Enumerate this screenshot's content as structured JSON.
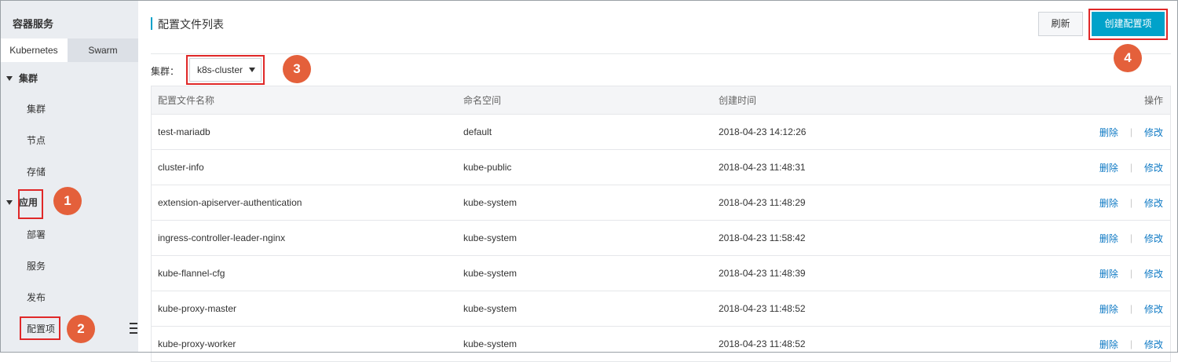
{
  "sidebar": {
    "title": "容器服务",
    "tabs": [
      {
        "label": "Kubernetes",
        "active": true
      },
      {
        "label": "Swarm",
        "active": false
      }
    ],
    "groups": [
      {
        "label": "集群",
        "items": [
          "集群",
          "节点",
          "存储"
        ]
      },
      {
        "label": "应用",
        "items": [
          "部署",
          "服务",
          "发布",
          "配置项"
        ]
      }
    ],
    "selected_item": "配置项"
  },
  "header": {
    "title": "配置文件列表",
    "refresh_label": "刷新",
    "create_label": "创建配置项"
  },
  "filter": {
    "cluster_label": "集群：",
    "cluster_value": "k8s-cluster"
  },
  "table": {
    "columns": [
      "配置文件名称",
      "命名空间",
      "创建时间",
      "操作"
    ],
    "rows": [
      {
        "name": "test-mariadb",
        "namespace": "default",
        "created": "2018-04-23 14:12:26"
      },
      {
        "name": "cluster-info",
        "namespace": "kube-public",
        "created": "2018-04-23 11:48:31"
      },
      {
        "name": "extension-apiserver-authentication",
        "namespace": "kube-system",
        "created": "2018-04-23 11:48:29"
      },
      {
        "name": "ingress-controller-leader-nginx",
        "namespace": "kube-system",
        "created": "2018-04-23 11:58:42"
      },
      {
        "name": "kube-flannel-cfg",
        "namespace": "kube-system",
        "created": "2018-04-23 11:48:39"
      },
      {
        "name": "kube-proxy-master",
        "namespace": "kube-system",
        "created": "2018-04-23 11:48:52"
      },
      {
        "name": "kube-proxy-worker",
        "namespace": "kube-system",
        "created": "2018-04-23 11:48:52"
      }
    ],
    "actions": {
      "delete": "删除",
      "edit": "修改"
    }
  },
  "annotations": {
    "steps": [
      "1",
      "2",
      "3",
      "4"
    ]
  },
  "colors": {
    "accent": "#00a2ca",
    "link": "#0e79c4",
    "highlight": "#e02828",
    "step_marker": "#e4603b"
  }
}
